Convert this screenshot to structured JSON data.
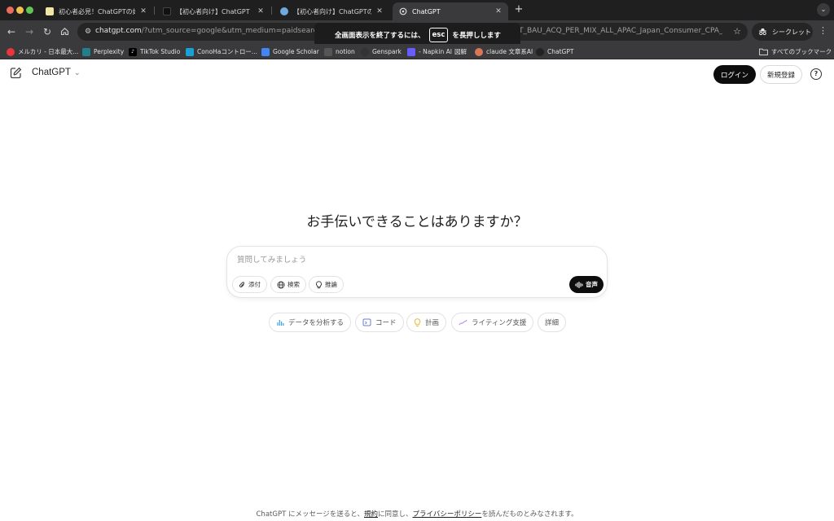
{
  "browser": {
    "tabs": [
      {
        "title": "初心者必見！ChatGPTの始め方とは？",
        "active": false
      },
      {
        "title": "【初心者向け】ChatGPT（OpenAI）",
        "active": false
      },
      {
        "title": "【初心者向け】ChatGPTのおすすめ",
        "active": false
      },
      {
        "title": "ChatGPT",
        "active": true
      }
    ],
    "url_host": "chatgpt.com",
    "url_rest": "/?utm_source=google&utm_medium=paidsearch_brand&utm_campaign=GOOG_C_SEM_GBR_Core_CHT_BAU_ACQ_PER_MIX_ALL_APAC_Japan_Consumer_CPA_BAU_Mix_Japanese&utm_term=...",
    "incognito_label": "シークレット",
    "fullscreen_toast": {
      "before": "全画面表示を終了するには、",
      "key": "esc",
      "after": "を長押しします"
    },
    "bookmarks": [
      {
        "label": "メルカリ - 日本最大...",
        "icon_color": "#e8363c"
      },
      {
        "label": "Perplexity",
        "icon_color": "#20808d"
      },
      {
        "label": "TikTok Studio",
        "icon_color": "#000000"
      },
      {
        "label": "ConoHaコントロー...",
        "icon_color": "#19a0d8"
      },
      {
        "label": "Google Scholar",
        "icon_color": "#4285f4"
      },
      {
        "label": "notion",
        "icon_color": "#555555"
      },
      {
        "label": "Genspark",
        "icon_color": "#333333"
      },
      {
        "label": "- Napkin AI",
        "icon_color": "#6b5cff"
      },
      {
        "label": "図解",
        "icon_color": ""
      },
      {
        "label": "claude 文章系AI",
        "icon_color": "#d97757"
      },
      {
        "label": "ChatGPT",
        "icon_color": "#222222"
      }
    ],
    "all_bookmarks_label": "すべてのブックマーク"
  },
  "header": {
    "model_name": "ChatGPT",
    "login_label": "ログイン",
    "signup_label": "新規登録",
    "help_symbol": "?"
  },
  "main": {
    "headline": "お手伝いできることはありますか？",
    "input_placeholder": "質問してみましょう",
    "attach_label": "添付",
    "search_label": "検索",
    "reason_label": "推論",
    "voice_label": "音声"
  },
  "suggestions": [
    {
      "label": "データを分析する",
      "icon": "bar-chart-icon",
      "color": "#35a0e8"
    },
    {
      "label": "コード",
      "icon": "code-icon",
      "color": "#6b7bd6"
    },
    {
      "label": "計画",
      "icon": "lightbulb-icon",
      "color": "#e8b93a"
    },
    {
      "label": "ライティング支援",
      "icon": "pen-icon",
      "color": "#b07ee8"
    },
    {
      "label": "詳細",
      "icon": "",
      "color": ""
    }
  ],
  "footer": {
    "prefix": "ChatGPT にメッセージを送ると、",
    "terms": "規約",
    "middle": "に同意し、",
    "privacy": "プライバシーポリシー",
    "suffix": "を読んだものとみなされます。"
  }
}
